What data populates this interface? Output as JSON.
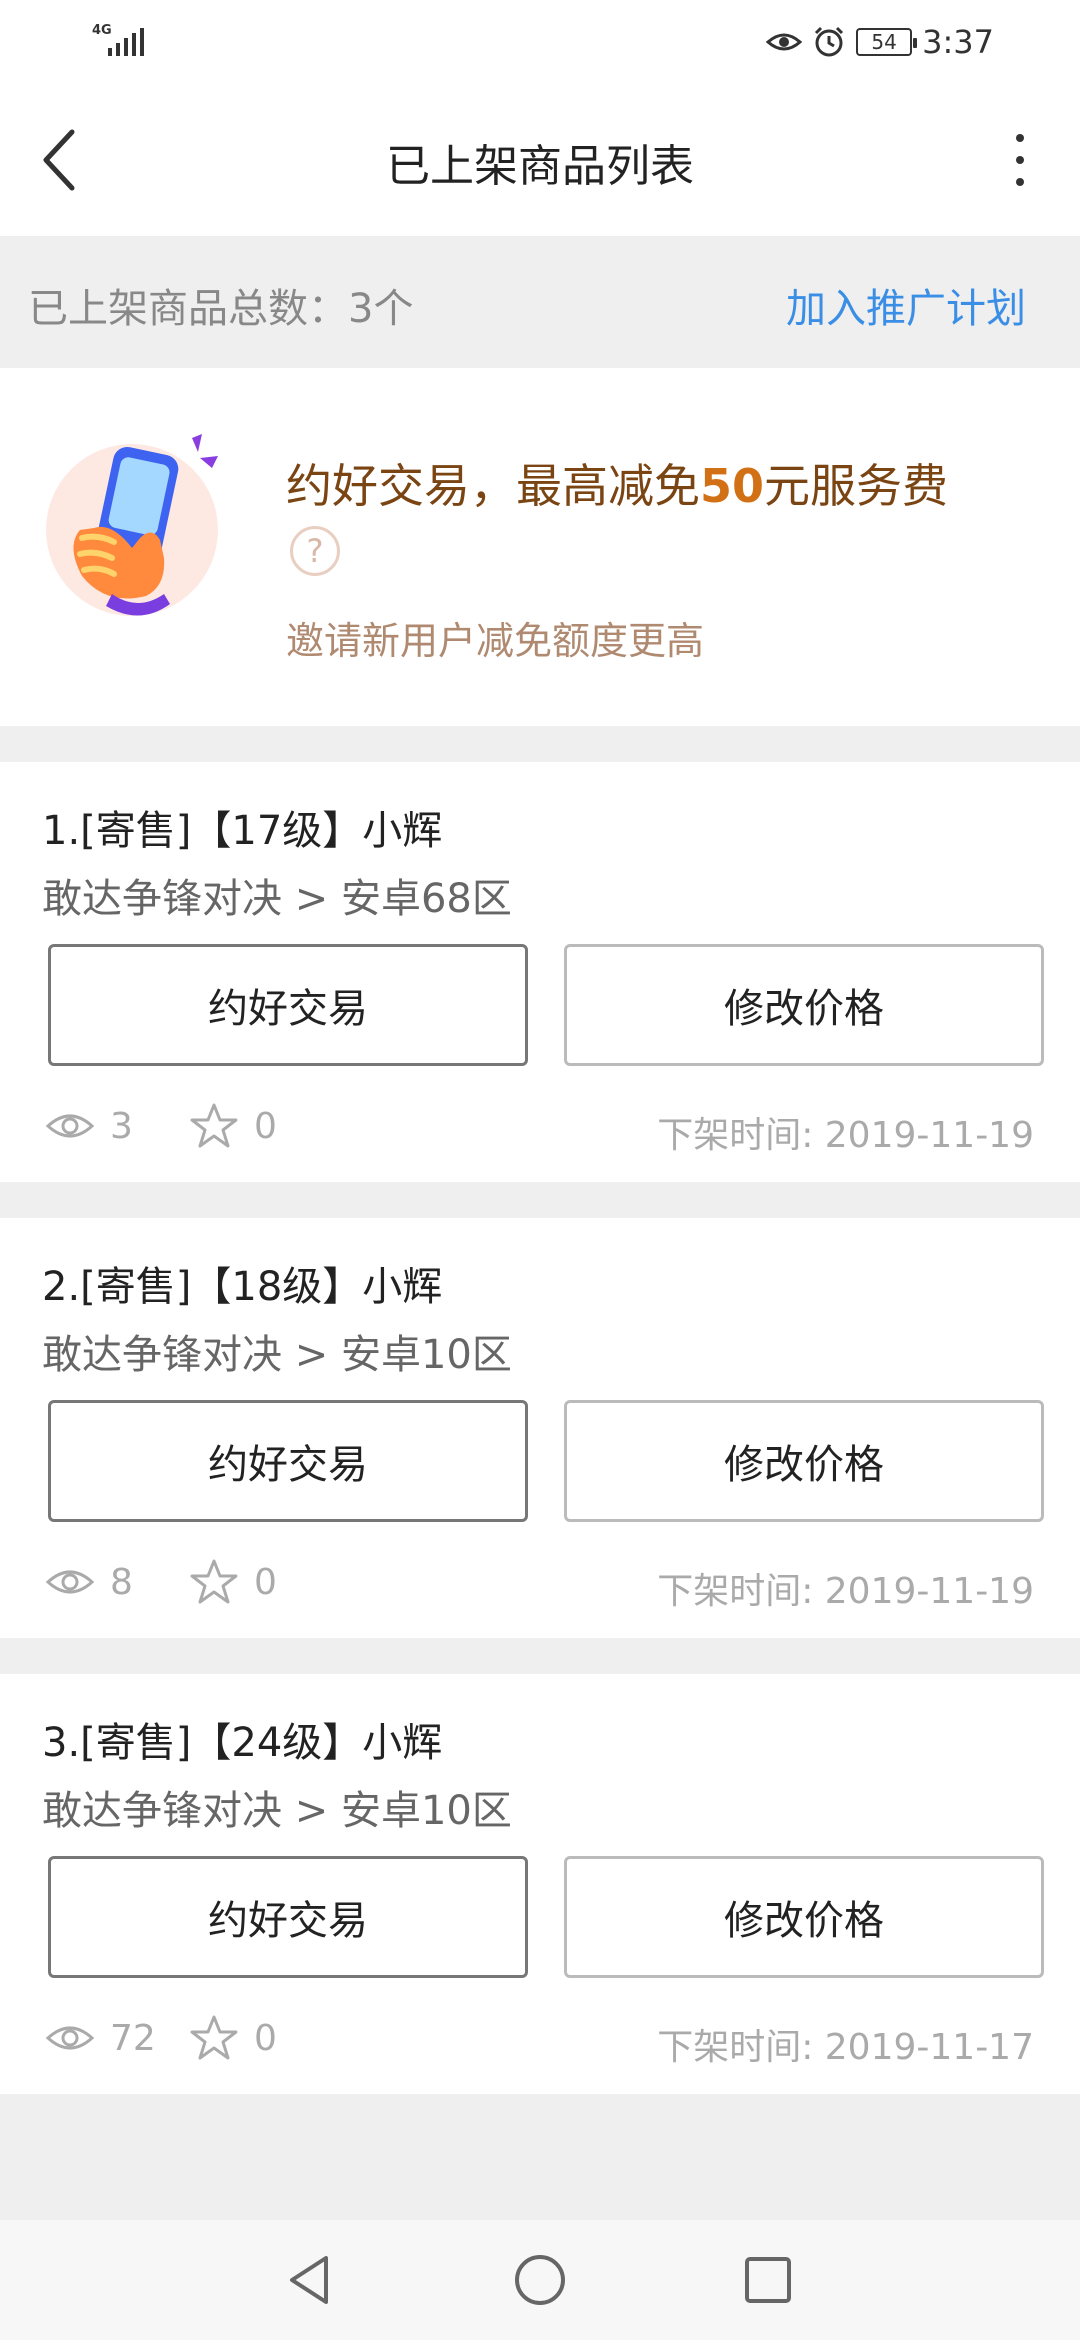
{
  "status_bar": {
    "network": "4G",
    "battery": "54",
    "time": "3:37"
  },
  "header": {
    "title": "已上架商品列表"
  },
  "summary": {
    "total_label": "已上架商品总数：3个",
    "promo_link": "加入推广计划"
  },
  "banner": {
    "title_prefix": "约好交易，最高减免",
    "title_amount": "50",
    "title_suffix": "元服务费",
    "help_glyph": "?",
    "subtitle": "邀请新用户减免额度更高"
  },
  "products": [
    {
      "title": "1.[寄售]【17级】小辉",
      "server": "敢达争锋对决 > 安卓68区",
      "deal_label": "约好交易",
      "price_label": "修改价格",
      "views": "3",
      "favorites": "0",
      "offline_time": "下架时间: 2019-11-19"
    },
    {
      "title": "2.[寄售]【18级】小辉",
      "server": "敢达争锋对决 > 安卓10区",
      "deal_label": "约好交易",
      "price_label": "修改价格",
      "views": "8",
      "favorites": "0",
      "offline_time": "下架时间: 2019-11-19"
    },
    {
      "title": "3.[寄售]【24级】小辉",
      "server": "敢达争锋对决 > 安卓10区",
      "deal_label": "约好交易",
      "price_label": "修改价格",
      "views": "72",
      "favorites": "0",
      "offline_time": "下架时间: 2019-11-17"
    }
  ],
  "icons": {
    "back": "back-arrow-icon",
    "more": "more-vertical-icon",
    "help": "help-circle-icon",
    "views": "eye-icon",
    "favorites": "star-icon",
    "nav_back": "triangle-back-icon",
    "nav_home": "circle-home-icon",
    "nav_recent": "square-recent-icon"
  },
  "colors": {
    "link": "#3a8ee6",
    "banner_title": "#7a4513",
    "banner_amount": "#d27015",
    "banner_sub": "#b08a70"
  }
}
